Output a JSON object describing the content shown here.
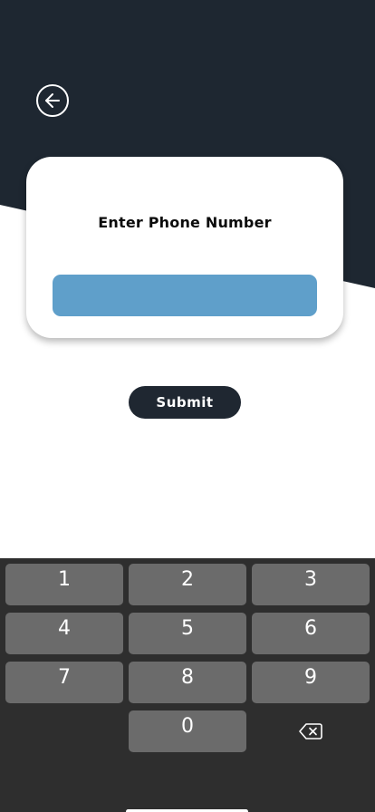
{
  "colors": {
    "header_background": "#1e2731",
    "input_background": "#5f9fca",
    "submit_background": "#1f2731",
    "keyboard_background": "#2e2e2e",
    "key_background": "#6b6b6b"
  },
  "header": {
    "back_icon": "arrow-left-circle-icon"
  },
  "card": {
    "title": "Enter Phone Number",
    "phone_value": "",
    "phone_placeholder": ""
  },
  "submit": {
    "label": "Submit"
  },
  "keyboard": {
    "keys": [
      "1",
      "2",
      "3",
      "4",
      "5",
      "6",
      "7",
      "8",
      "9",
      "0"
    ],
    "backspace_icon": "backspace-icon"
  }
}
